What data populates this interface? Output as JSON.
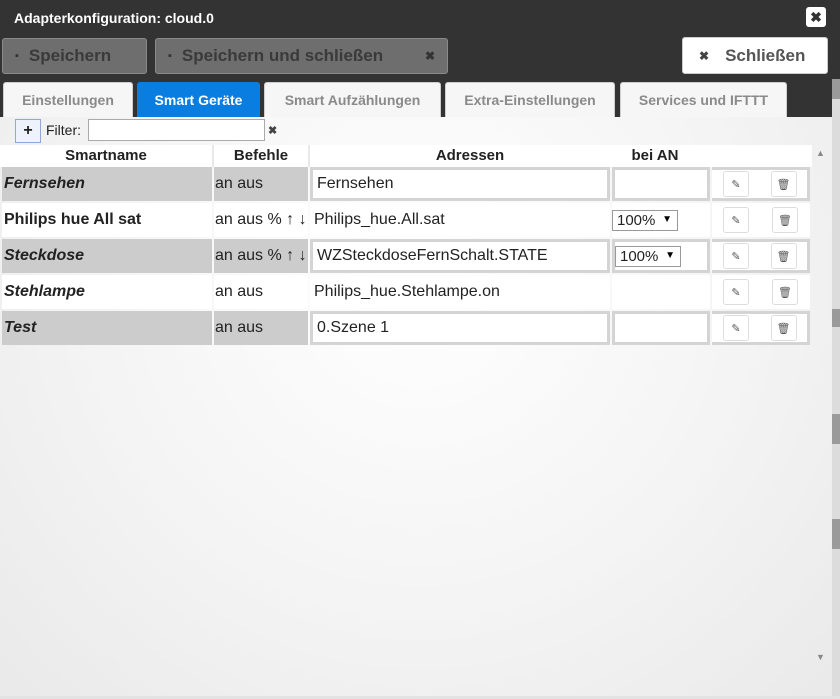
{
  "window": {
    "title": "Adapterkonfiguration: cloud.0"
  },
  "toolbar": {
    "save_label": "Speichern",
    "save_close_label": "Speichern und schließen",
    "close_label": "Schließen"
  },
  "tabs": [
    {
      "label": "Einstellungen",
      "active": false
    },
    {
      "label": "Smart Geräte",
      "active": true
    },
    {
      "label": "Smart Aufzählungen",
      "active": false
    },
    {
      "label": "Extra-Einstellungen",
      "active": false
    },
    {
      "label": "Services und IFTTT",
      "active": false
    }
  ],
  "filter": {
    "label": "Filter:",
    "value": ""
  },
  "table": {
    "headers": {
      "smartname": "Smartname",
      "befehle": "Befehle",
      "adressen": "Adressen",
      "bei_an": "bei AN"
    },
    "rows": [
      {
        "smartname": "Fernsehen",
        "befehle": "an aus",
        "adresse": "Fernsehen",
        "bei_an": ""
      },
      {
        "smartname": "Philips hue All sat",
        "befehle": "an aus % ↑ ↓",
        "adresse": "Philips_hue.All.sat",
        "bei_an": "100%"
      },
      {
        "smartname": "Steckdose",
        "befehle": "an aus % ↑ ↓",
        "adresse": "WZSteckdoseFernSchalt.STATE",
        "bei_an": "100%"
      },
      {
        "smartname": "Stehlampe",
        "befehle": "an aus",
        "adresse": "Philips_hue.Stehlampe.on",
        "bei_an": ""
      },
      {
        "smartname": "Test",
        "befehle": "an aus",
        "adresse": "0.Szene 1",
        "bei_an": ""
      }
    ]
  },
  "colors": {
    "title_bar": "#333333",
    "active_tab": "#0a7ee0",
    "row_shade": "#cccccc"
  },
  "icons": {
    "save": "floppy-icon",
    "close": "close-icon",
    "add": "plus-icon",
    "edit": "pencil-icon",
    "delete": "trash-icon",
    "dropdown": "caret-down-icon"
  }
}
